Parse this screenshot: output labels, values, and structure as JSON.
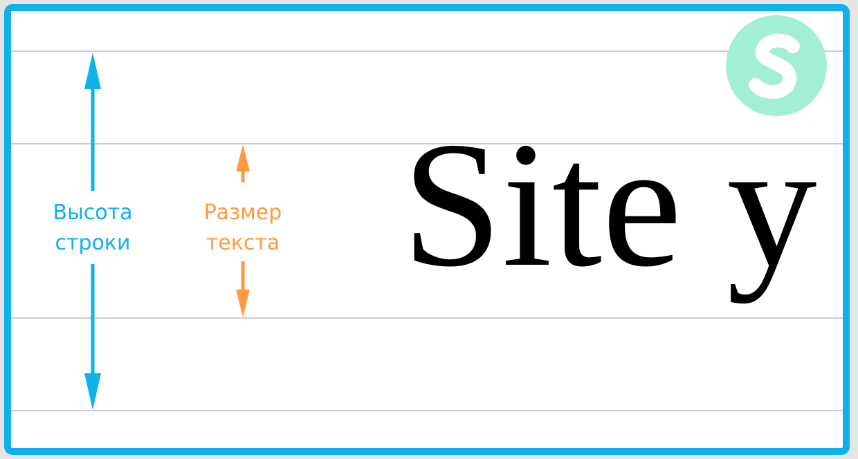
{
  "labels": {
    "line_height": [
      "Высота",
      "строки"
    ],
    "text_size": [
      "Размер",
      "текста"
    ]
  },
  "sample_text": "Site y",
  "logo": {
    "icon": "s-brand-logo",
    "letter": "S"
  },
  "colors": {
    "frame": "#0fb0ec",
    "line_height_arrow": "#0fb0ec",
    "text_size_arrow": "#ff9a40",
    "guidelines": "#cccccc",
    "logo_bg": "#a3eed6",
    "logo_fg": "#ffffff"
  }
}
